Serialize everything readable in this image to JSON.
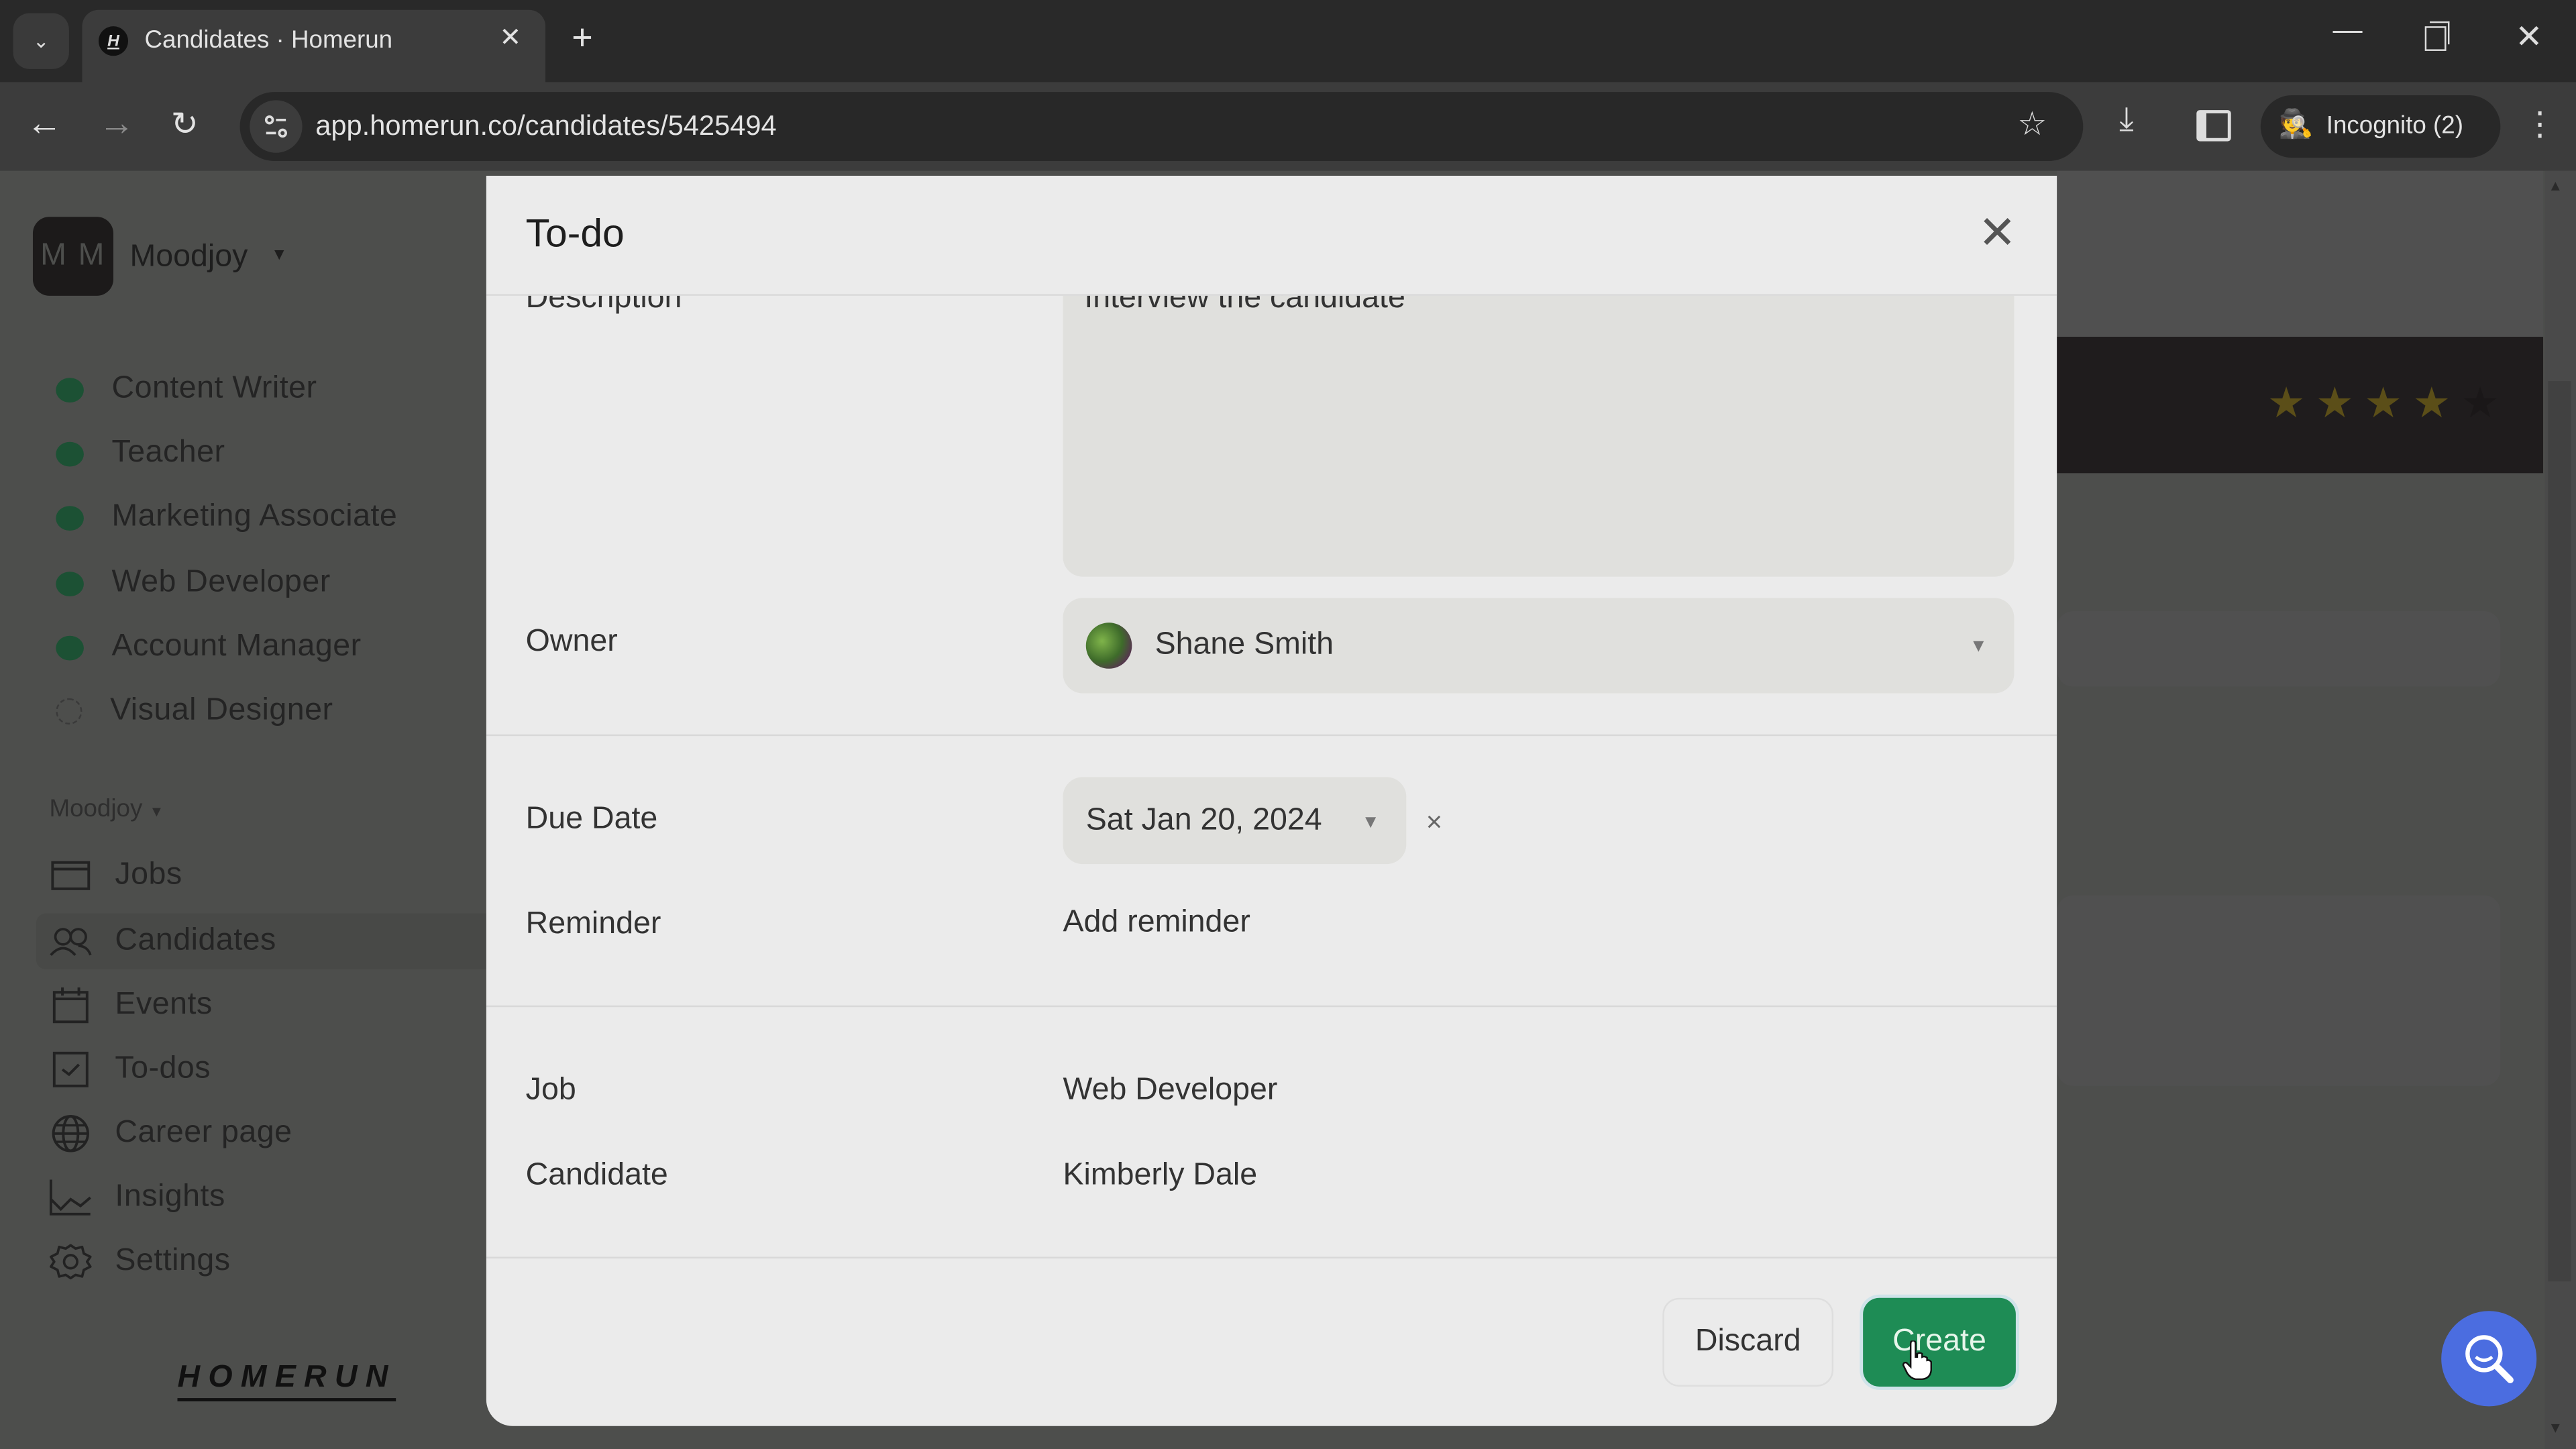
{
  "browser": {
    "tab_title": "Candidates · Homerun",
    "favicon_letter": "H",
    "url": "app.homerun.co/candidates/5425494",
    "profile_label": "Incognito (2)",
    "controls": {
      "back": "←",
      "forward": "→",
      "reload": "↻",
      "star": "☆",
      "download": "⤓",
      "menu": "⋮",
      "new_tab": "+",
      "tab_close": "✕",
      "tab_search": "⌄",
      "min": "—",
      "close": "✕"
    }
  },
  "sidebar": {
    "workspace_initials": "M M",
    "workspace_name": "Moodjoy",
    "jobs": [
      {
        "label": "Content Writer",
        "status": "published"
      },
      {
        "label": "Teacher",
        "status": "published"
      },
      {
        "label": "Marketing Associate",
        "status": "published"
      },
      {
        "label": "Web Developer",
        "status": "published"
      },
      {
        "label": "Account Manager",
        "status": "published"
      },
      {
        "label": "Visual Designer",
        "status": "draft"
      }
    ],
    "section_header": "Moodjoy",
    "nav": [
      {
        "label": "Jobs",
        "icon": "jobs-icon"
      },
      {
        "label": "Candidates",
        "icon": "candidates-icon",
        "active": true
      },
      {
        "label": "Events",
        "icon": "calendar-icon"
      },
      {
        "label": "To-dos",
        "icon": "checkbox-icon"
      },
      {
        "label": "Career page",
        "icon": "globe-icon"
      },
      {
        "label": "Insights",
        "icon": "chart-icon"
      },
      {
        "label": "Settings",
        "icon": "gear-icon"
      }
    ],
    "logo": "HOMERUN"
  },
  "background_page": {
    "rating": {
      "value": 4,
      "max": 5
    }
  },
  "modal": {
    "title": "To-do",
    "fields": {
      "description": {
        "label": "Description",
        "value": "Interview the candidate"
      },
      "owner": {
        "label": "Owner",
        "value": "Shane Smith"
      },
      "due_date": {
        "label": "Due Date",
        "value": "Sat Jan 20, 2024"
      },
      "reminder": {
        "label": "Reminder",
        "value": "Add reminder"
      },
      "job": {
        "label": "Job",
        "value": "Web Developer"
      },
      "candidate": {
        "label": "Candidate",
        "value": "Kimberly Dale"
      }
    },
    "buttons": {
      "discard": "Discard",
      "create": "Create"
    },
    "close_glyph": "✕",
    "chevron_glyph": "⌄",
    "clear_glyph": "×"
  },
  "colors": {
    "primary_green": "#1e8c55",
    "job_status_green": "#1c5134",
    "fab_blue": "#4b6de0",
    "star_gold_dimmed": "#5b4e18"
  }
}
